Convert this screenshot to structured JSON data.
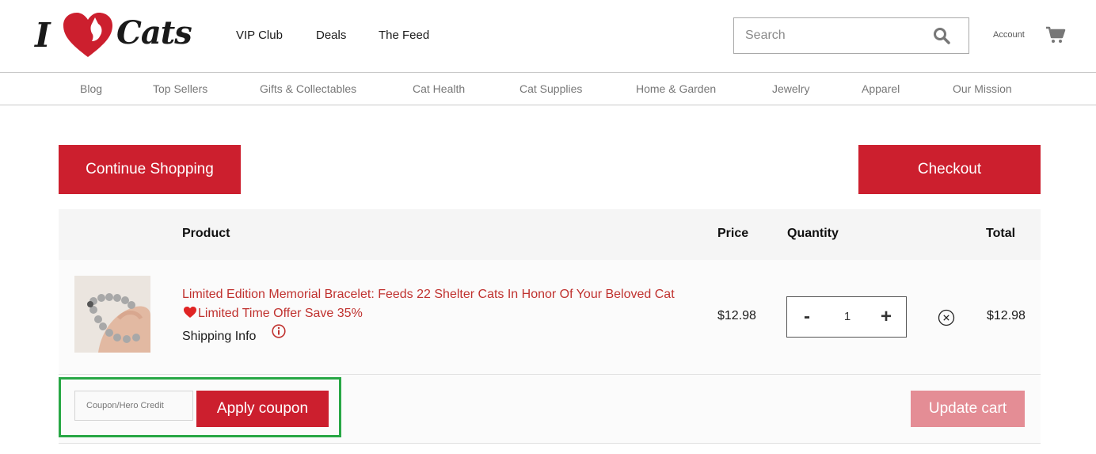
{
  "brand": {
    "logo_i": "I",
    "logo_word": "Cats",
    "logo_heart_color": "#cc1f2e"
  },
  "topnav": [
    {
      "label": "VIP Club"
    },
    {
      "label": "Deals"
    },
    {
      "label": "The Feed"
    }
  ],
  "search": {
    "placeholder": "Search",
    "icon": "search-icon"
  },
  "account": {
    "label": "Account",
    "cart_icon": "cart-icon"
  },
  "categories": [
    {
      "label": "Blog"
    },
    {
      "label": "Top Sellers"
    },
    {
      "label": "Gifts & Collectables"
    },
    {
      "label": "Cat Health"
    },
    {
      "label": "Cat Supplies"
    },
    {
      "label": "Home & Garden"
    },
    {
      "label": "Jewelry"
    },
    {
      "label": "Apparel"
    },
    {
      "label": "Our Mission"
    }
  ],
  "buttons": {
    "continue": "Continue Shopping",
    "checkout": "Checkout",
    "apply_coupon": "Apply coupon",
    "update_cart": "Update cart"
  },
  "table": {
    "headers": {
      "product": "Product",
      "price": "Price",
      "quantity": "Quantity",
      "total": "Total"
    },
    "rows": [
      {
        "title_part1": "Limited Edition Memorial Bracelet: Feeds 22 Shelter Cats In Honor Of Your Beloved Cat",
        "title_part2": "Limited Time Offer Save 35%",
        "shipping": "Shipping Info",
        "price": "$12.98",
        "quantity_minus": "-",
        "quantity": "1",
        "quantity_plus": "+",
        "total": "$12.98"
      }
    ]
  },
  "coupon": {
    "placeholder": "Coupon/Hero Credit"
  },
  "colors": {
    "accent": "#cc1f2e",
    "update_disabled": "#e48d95",
    "highlight": "#28a745",
    "product_link": "#c0322f"
  }
}
